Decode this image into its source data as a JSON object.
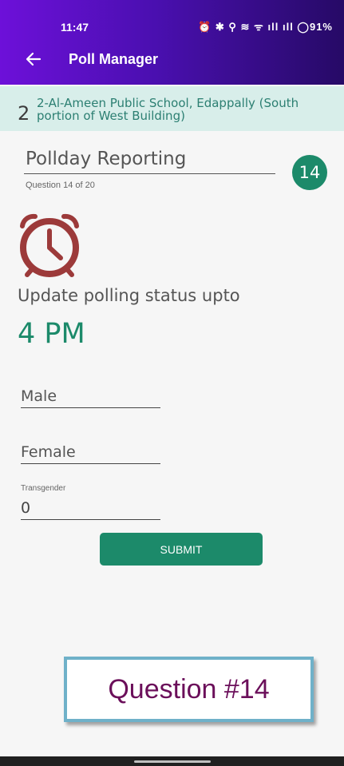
{
  "status_bar": {
    "time": "11:47",
    "icons": "⏰ ✱ ⚲ ≋ ᯤ ıll ıll ◯91%",
    "battery": "91%"
  },
  "toolbar": {
    "title": "Poll Manager"
  },
  "booth": {
    "number": "2",
    "name": "2-Al-Ameen Public School, Edappally (South portion of West Building)"
  },
  "question": {
    "title": "Pollday Reporting",
    "subtitle": "Question 14 of 20",
    "badge": "14"
  },
  "prompt": {
    "label": "Update polling status upto",
    "time": "4 PM"
  },
  "form": {
    "male_placeholder": "Male",
    "female_placeholder": "Female",
    "transgender_label": "Transgender",
    "transgender_value": "0",
    "submit_label": "SUBMIT"
  },
  "callout": {
    "text": "Question #14"
  },
  "colors": {
    "accent": "#1c8a6a",
    "appbar": "#6d10d9",
    "clock": "#9c3a3a",
    "callout_text": "#6b0f5a"
  }
}
